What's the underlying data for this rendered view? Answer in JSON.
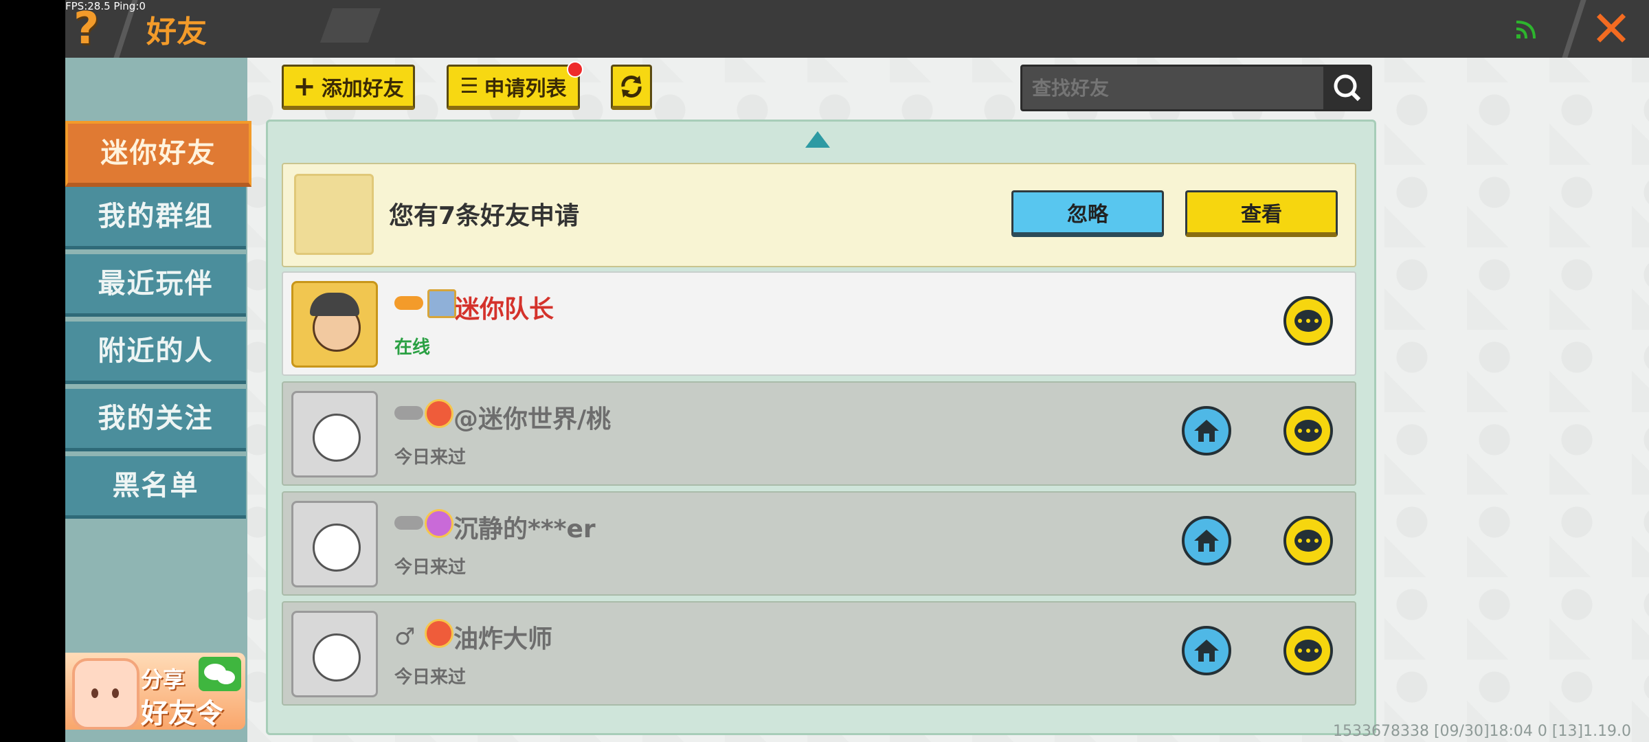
{
  "debug": {
    "fps_text": "FPS:28.5  Ping:0"
  },
  "header": {
    "title": "好友",
    "help_icon": "question-mark-icon",
    "close_icon": "close-x-icon",
    "signal_color": "#2db52d"
  },
  "sidebar": {
    "items": [
      {
        "label": "迷你好友",
        "active": true
      },
      {
        "label": "我的群组",
        "active": false
      },
      {
        "label": "最近玩伴",
        "active": false
      },
      {
        "label": "附近的人",
        "active": false
      },
      {
        "label": "我的关注",
        "active": false
      },
      {
        "label": "黑名单",
        "active": false
      }
    ],
    "share_banner": {
      "line1": "分享",
      "line2": "好友令"
    }
  },
  "toolbar": {
    "add_friend_label": "添加好友",
    "request_list_label": "申请列表",
    "search_placeholder": "查找好友"
  },
  "request_card": {
    "text": "您有7条好友申请",
    "ignore_label": "忽略",
    "view_label": "查看"
  },
  "friends": [
    {
      "name": "迷你队长",
      "status": "在线",
      "online": true,
      "has_home": false
    },
    {
      "name": "@迷你世界/桃",
      "status": "今日来过",
      "online": false,
      "has_home": true
    },
    {
      "name": "沉静的***er",
      "status": "今日来过",
      "online": false,
      "has_home": true
    },
    {
      "name": "油炸大师",
      "status": "今日来过",
      "online": false,
      "has_home": true,
      "gender": "♂"
    }
  ],
  "footer": {
    "info": "1533678338    [09/30]18:04 0  [13]1.19.0"
  },
  "colors": {
    "accent_orange": "#f39b2a",
    "button_yellow": "#f6d60f",
    "button_blue": "#58c6ef",
    "online_green": "#2aa043",
    "name_red": "#d4322b"
  }
}
